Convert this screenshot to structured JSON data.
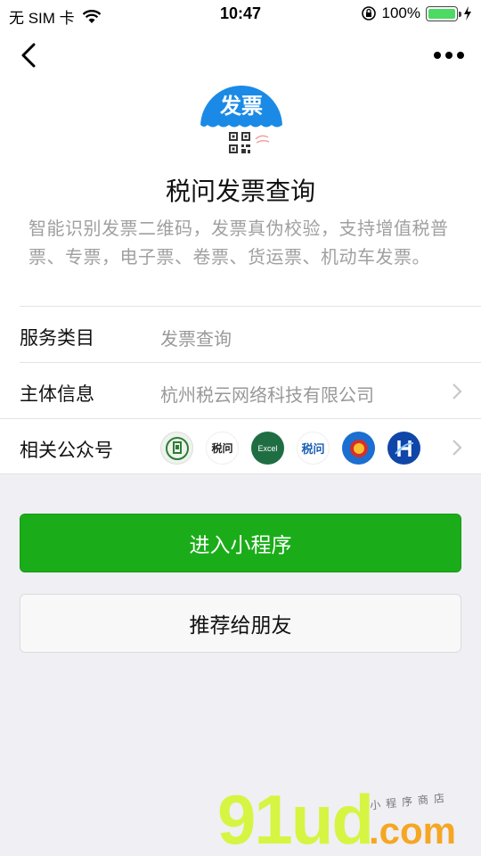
{
  "status_bar": {
    "carrier": "无 SIM 卡",
    "time": "10:47",
    "battery": "100%"
  },
  "app": {
    "icon_text": "发票",
    "name": "税问发票查询",
    "description": "智能识别发票二维码，发票真伪校验，支持增值税普票、专票，电子票、卷票、货运票、机动车发票。"
  },
  "rows": {
    "category": {
      "label": "服务类目",
      "value": "发票查询"
    },
    "entity": {
      "label": "主体信息",
      "value": "杭州税云网络科技有限公司"
    },
    "accounts": {
      "label": "相关公众号",
      "icons": [
        {
          "name": "tax-guide-icon",
          "text": ""
        },
        {
          "name": "shuiwen-icon",
          "text": "税问"
        },
        {
          "name": "excel-icon",
          "text": "Excel"
        },
        {
          "name": "shuiwen-blue-icon",
          "text": "税问"
        },
        {
          "name": "tax-bureau-emblem-icon",
          "text": ""
        },
        {
          "name": "h-logo-icon",
          "text": ""
        }
      ]
    }
  },
  "buttons": {
    "enter": "进入小程序",
    "share": "推荐给朋友"
  },
  "watermark": {
    "main": "91ud",
    "domain": ".com",
    "tagline": "小程序商店"
  },
  "colors": {
    "primary_green": "#1aad19",
    "icon_blue": "#1a8ae6",
    "background": "#efeff4"
  }
}
